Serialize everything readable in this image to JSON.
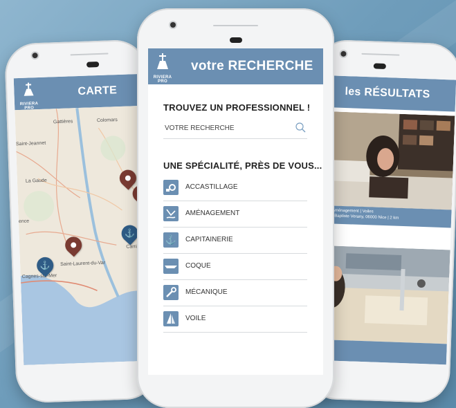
{
  "colors": {
    "brand": "#6b8fb2",
    "pin_brown": "#7a3b32",
    "pin_blue": "#2f5c86",
    "sea": "#a9c6e2"
  },
  "brand": {
    "name": "RIVIERA PRO"
  },
  "map_screen": {
    "title": "CARTE",
    "places": [
      "Gattières",
      "Colomars",
      "Saint-Jeannet",
      "La Gaude",
      "Saint-Laurent-du-Var",
      "Cagnes-sur-Mer",
      "Carras",
      "ence"
    ]
  },
  "search_screen": {
    "title": "votre RECHERCHE",
    "find_heading": "TROUVEZ UN PROFESSIONNEL !",
    "search_placeholder": "VOTRE RECHERCHE",
    "specialty_heading": "UNE SPÉCIALITÉ, PRÈS DE VOUS...",
    "specialties": [
      {
        "label": "ACCASTILLAGE",
        "icon": "accastillage-icon"
      },
      {
        "label": "AMÉNAGEMENT",
        "icon": "amenagement-icon"
      },
      {
        "label": "CAPITAINERIE",
        "icon": "anchor-icon"
      },
      {
        "label": "COQUE",
        "icon": "hull-icon"
      },
      {
        "label": "MÉCANIQUE",
        "icon": "wrench-icon"
      },
      {
        "label": "VOILE",
        "icon": "sail-icon"
      }
    ]
  },
  "results_screen": {
    "title": "les RÉSULTATS",
    "results": [
      {
        "tags": "ge | Aménagement | Voiles",
        "address": "Jean-Baptiste Verany, 06000 Nice  |  2 km"
      },
      {
        "tags": "",
        "address": "co"
      }
    ]
  }
}
